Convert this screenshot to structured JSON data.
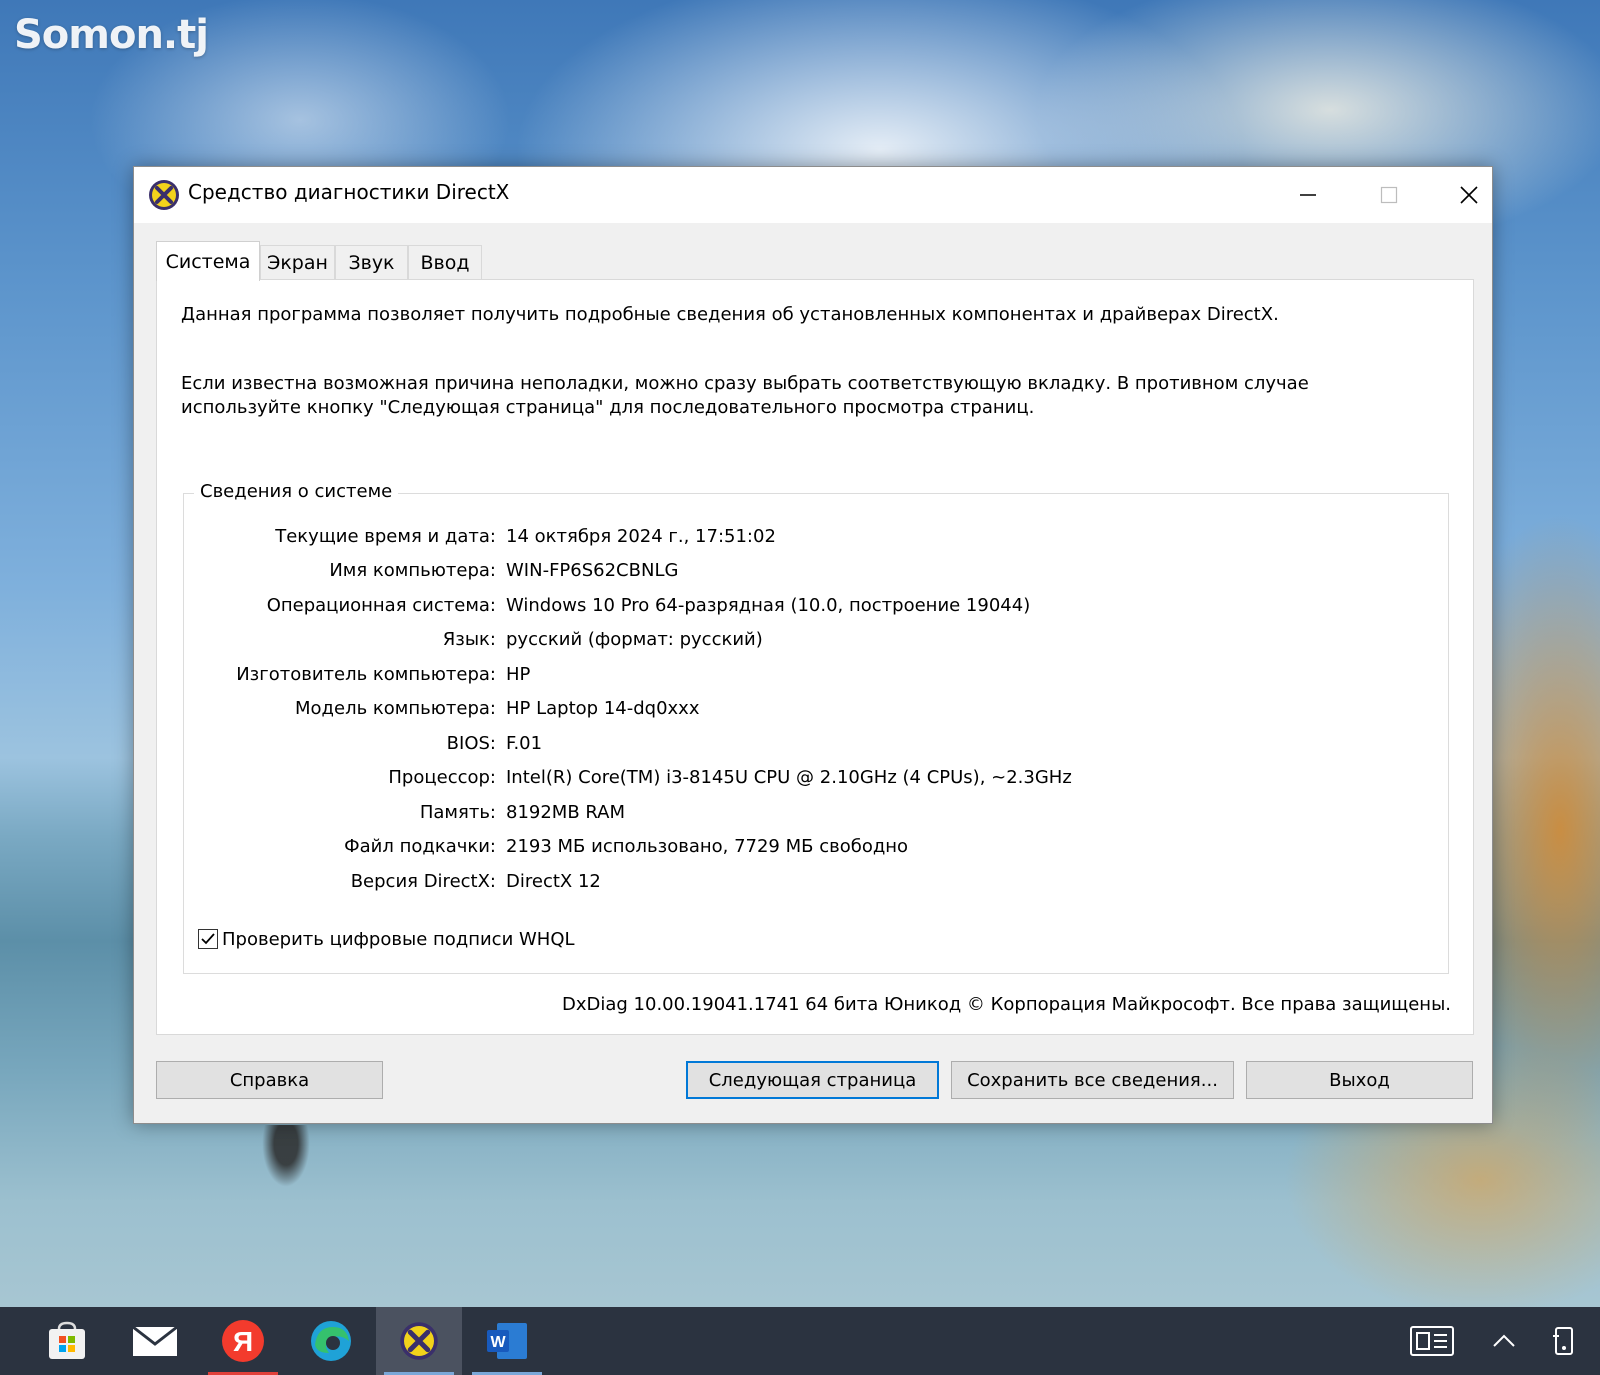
{
  "desktop": {
    "watermark": "Somon.tj"
  },
  "window": {
    "title": "Средство диагностики DirectX",
    "icon": "dxdiag-icon",
    "controls": {
      "minimize": "minimize-icon",
      "maximize": "maximize-icon",
      "close": "close-icon"
    }
  },
  "tabs": [
    {
      "label": "Система",
      "active": true
    },
    {
      "label": "Экран",
      "active": false
    },
    {
      "label": "Звук",
      "active": false
    },
    {
      "label": "Ввод",
      "active": false
    }
  ],
  "intro": {
    "line1": "Данная программа позволяет получить подробные сведения об установленных компонентах и драйверах DirectX.",
    "line2": "Если известна возможная причина неполадки, можно сразу выбрать соответствующую вкладку. В противном случае используйте кнопку \"Следующая страница\" для последовательного просмотра страниц."
  },
  "system_info": {
    "title": "Сведения о системе",
    "rows": [
      {
        "label": "Текущие время и дата:",
        "value": "14 октября 2024 г., 17:51:02"
      },
      {
        "label": "Имя компьютера:",
        "value": "WIN-FP6S62CBNLG"
      },
      {
        "label": "Операционная система:",
        "value": "Windows 10 Pro 64-разрядная (10.0, построение 19044)"
      },
      {
        "label": "Язык:",
        "value": "русский (формат: русский)"
      },
      {
        "label": "Изготовитель компьютера:",
        "value": "HP"
      },
      {
        "label": "Модель компьютера:",
        "value": "HP Laptop 14-dq0xxx"
      },
      {
        "label": "BIOS:",
        "value": "F.01"
      },
      {
        "label": "Процессор:",
        "value": "Intel(R) Core(TM) i3-8145U CPU @ 2.10GHz (4 CPUs), ~2.3GHz"
      },
      {
        "label": "Память:",
        "value": "8192MB RAM"
      },
      {
        "label": "Файл подкачки:",
        "value": "2193 МБ использовано, 7729 МБ свободно"
      },
      {
        "label": "Версия DirectX:",
        "value": "DirectX 12"
      }
    ],
    "whql_label": "Проверить цифровые подписи WHQL",
    "whql_checked": true
  },
  "copyright": "DxDiag 10.00.19041.1741 64 бита Юникод © Корпорация Майкрософт. Все права защищены.",
  "buttons": {
    "help": "Справка",
    "next": "Следующая страница",
    "save": "Сохранить все сведения...",
    "exit": "Выход"
  },
  "taskbar": {
    "apps": [
      "store-icon",
      "mail-icon",
      "yandex-icon",
      "edge-icon",
      "dxdiag-icon",
      "word-icon"
    ],
    "active_app": "dxdiag-icon",
    "tray": [
      "news-icon",
      "chevron-up-icon",
      "device-icon"
    ]
  },
  "colors": {
    "accent": "#0078d7",
    "taskbar": "#2b3340",
    "window_bg": "#f0f0f0"
  }
}
